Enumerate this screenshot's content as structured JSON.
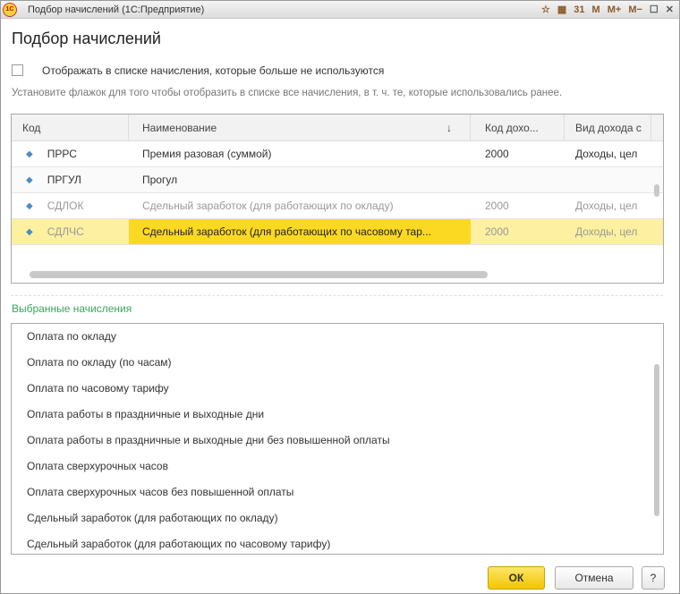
{
  "window": {
    "title": "Подбор начислений  (1С:Предприятие)",
    "logo": "1С",
    "tools": [
      "☆",
      "▦",
      "31",
      "M",
      "M+",
      "M−",
      "☐",
      "✕"
    ]
  },
  "page_title": "Подбор начислений",
  "show_unused_label": "Отображать в списке начисления, которые больше не используются",
  "hint": "Установите флажок для того чтобы отобразить в списке все начисления, в т. ч. те, которые использовались ранее.",
  "table": {
    "headers": [
      "Код",
      "Наименование",
      "Код дохо...",
      "Вид дохода с"
    ],
    "sort_icon": "↓",
    "rows": [
      {
        "code": "ПРРС",
        "name": "Премия разовая (суммой)",
        "income_code": "2000",
        "income_type": "Доходы, цел",
        "muted": false
      },
      {
        "code": "ПРГУЛ",
        "name": "Прогул",
        "income_code": "",
        "income_type": "",
        "muted": false
      },
      {
        "code": "СДЛОК",
        "name": "Сдельный заработок (для работающих по окладу)",
        "income_code": "2000",
        "income_type": "Доходы, цел",
        "muted": true
      },
      {
        "code": "СДЛЧС",
        "name": "Сдельный заработок (для работающих по часовому тар...",
        "income_code": "2000",
        "income_type": "Доходы, цел",
        "muted": true,
        "selected": true
      }
    ]
  },
  "selected_section": "Выбранные начисления",
  "selected_items": [
    "Оплата по окладу",
    "Оплата по окладу (по часам)",
    "Оплата по часовому тарифу",
    "Оплата работы в праздничные и выходные дни",
    "Оплата работы в праздничные и выходные дни без повышенной оплаты",
    "Оплата сверхурочных часов",
    "Оплата сверхурочных часов без повышенной оплаты",
    "Сдельный заработок (для работающих по окладу)",
    "Сдельный заработок (для работающих по часовому тарифу)"
  ],
  "buttons": {
    "ok": "ОК",
    "cancel": "Отмена",
    "help": "?"
  }
}
